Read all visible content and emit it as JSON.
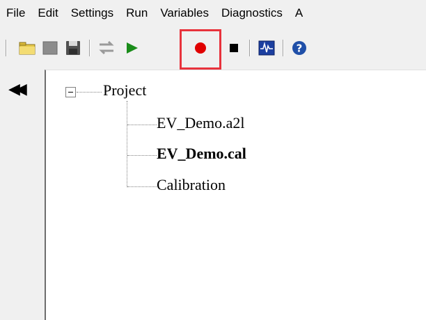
{
  "menu": {
    "items": [
      "File",
      "Edit",
      "Settings",
      "Run",
      "Variables",
      "Diagnostics",
      "A"
    ]
  },
  "toolbar": {
    "buttons": [
      {
        "name": "open-project-button",
        "icon": "folder-icon"
      },
      {
        "name": "project-button",
        "icon": "gray-square-icon"
      },
      {
        "name": "save-button",
        "icon": "floppy-disk-icon"
      },
      {
        "name": "transfer-button",
        "icon": "transfer-arrows-icon"
      },
      {
        "name": "run-button",
        "icon": "play-icon",
        "color": "#1a8c1a"
      },
      {
        "name": "record-button",
        "icon": "record-icon",
        "color": "#e00000"
      },
      {
        "name": "stop-button",
        "icon": "stop-icon",
        "color": "#000000"
      },
      {
        "name": "scope-button",
        "icon": "oscilloscope-icon"
      },
      {
        "name": "help-button",
        "icon": "help-icon",
        "color": "#1f4fa8"
      }
    ],
    "highlight_color": "#e8323c"
  },
  "sidebar": {
    "collapse_icon": "double-chevron-left-icon",
    "collapse_glyph": "◀◀"
  },
  "tree": {
    "root": {
      "label": "Project",
      "expanded": true
    },
    "children": [
      {
        "label": "EV_Demo.a2l",
        "bold": false
      },
      {
        "label": "EV_Demo.cal",
        "bold": true
      },
      {
        "label": "Calibration",
        "bold": false
      }
    ]
  }
}
